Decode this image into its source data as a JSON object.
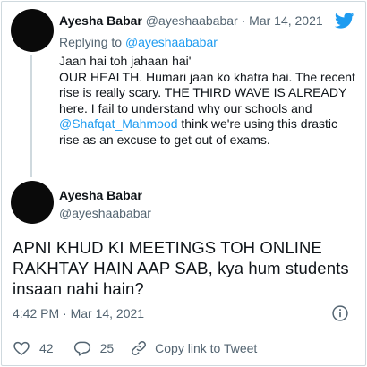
{
  "colors": {
    "accent": "#1d9bf0",
    "text": "#0f1419",
    "muted": "#536471",
    "border": "#cfd9de"
  },
  "parent_tweet": {
    "name": "Ayesha Babar",
    "handle": "@ayeshaababar",
    "separator": "·",
    "date": "Mar 14, 2021",
    "replying_to_prefix": "Replying to",
    "replying_to_handle": "@ayeshaababar",
    "line1": "Jaan hai toh jahaan hai'",
    "line2": "OUR HEALTH. Humari jaan ko khatra hai. The recent rise is really scary. THE THIRD WAVE IS ALREADY here. I fail to understand why our schools and",
    "mention": "@Shafqat_Mahmood",
    "line3": "think we're using this drastic rise as an excuse to get out of exams."
  },
  "brand_icon": "twitter-bird-icon",
  "main_tweet": {
    "name": "Ayesha Babar",
    "handle": "@ayeshaababar",
    "text": "APNI KHUD KI MEETINGS TOH ONLINE RAKHTAY HAIN AAP SAB, kya hum students insaan nahi hain?",
    "timestamp": "4:42 PM · Mar 14, 2021"
  },
  "actions": {
    "like_icon": "heart-icon",
    "like_count": "42",
    "reply_icon": "reply-bubble-icon",
    "reply_count": "25",
    "copy_icon": "link-icon",
    "copy_label": "Copy link to Tweet"
  }
}
